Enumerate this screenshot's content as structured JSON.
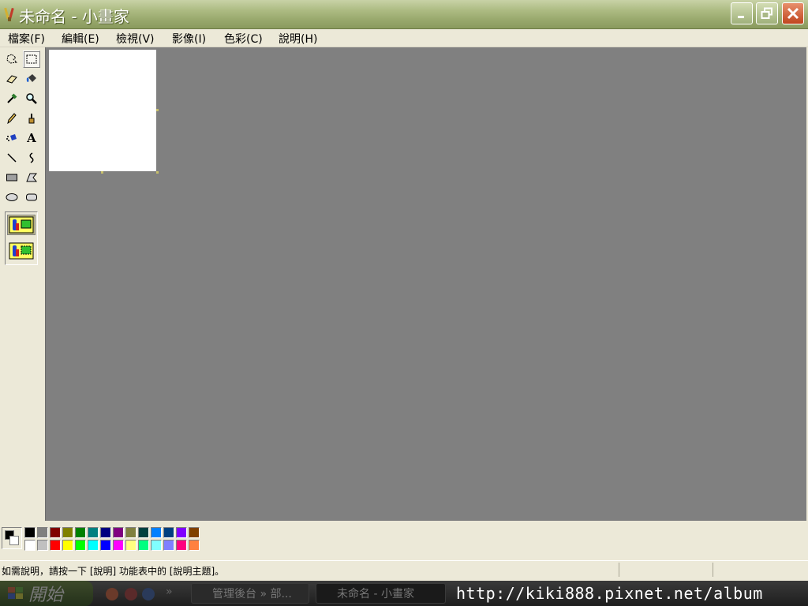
{
  "window": {
    "title": "未命名 - 小畫家",
    "controls": [
      "minimize-icon",
      "restore-icon",
      "close-icon"
    ]
  },
  "menu": {
    "items": [
      "檔案(F)",
      "編輯(E)",
      "檢視(V)",
      "影像(I)",
      "色彩(C)",
      "說明(H)"
    ]
  },
  "toolbox": {
    "tools": [
      "free-form-select-icon",
      "rect-select-icon",
      "eraser-icon",
      "fill-bucket-icon",
      "eyedropper-icon",
      "magnifier-icon",
      "pencil-icon",
      "brush-icon",
      "airbrush-icon",
      "text-icon",
      "line-icon",
      "curve-icon",
      "rectangle-icon",
      "polygon-icon",
      "ellipse-icon",
      "rounded-rect-icon"
    ],
    "text_tool_glyph": "A",
    "selected_tool": "rect-select-icon",
    "options": [
      "opaque-selection-icon",
      "transparent-selection-icon"
    ]
  },
  "palette": {
    "foreground": "#000000",
    "background": "#ffffff",
    "top_row": [
      "#000000",
      "#808080",
      "#800000",
      "#808000",
      "#008000",
      "#008080",
      "#000080",
      "#800080",
      "#808040",
      "#004040",
      "#0080ff",
      "#004080",
      "#8000ff",
      "#804000"
    ],
    "bottom_row": [
      "#ffffff",
      "#c0c0c0",
      "#ff0000",
      "#ffff00",
      "#00ff00",
      "#00ffff",
      "#0000ff",
      "#ff00ff",
      "#ffff80",
      "#00ff80",
      "#80ffff",
      "#8080ff",
      "#ff0080",
      "#ff8040"
    ]
  },
  "status": {
    "text": "如需說明，請按一下 [說明] 功能表中的 [說明主題]。"
  },
  "taskbar": {
    "start_label": "開始",
    "quick_more": "»",
    "tasks": [
      "管理後台 » 部...",
      "未命名 - 小畫家"
    ]
  },
  "watermark": "http://kiki888.pixnet.net/album"
}
